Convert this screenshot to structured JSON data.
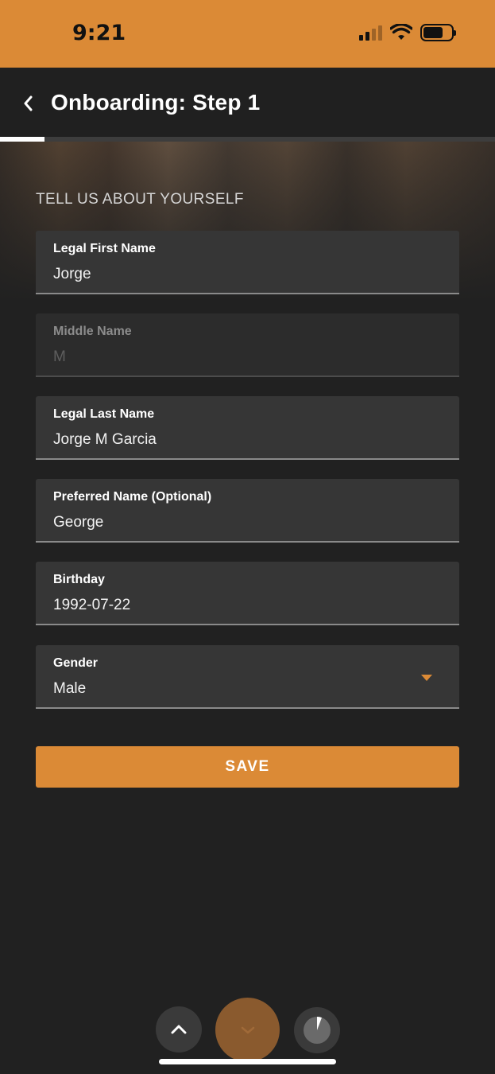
{
  "status_bar": {
    "time": "9:21",
    "background": "#db8a36"
  },
  "header": {
    "title": "Onboarding: Step 1",
    "back_icon": "chevron-left-icon"
  },
  "progress": {
    "fraction": 0.09
  },
  "section": {
    "heading": "TELL US ABOUT YOURSELF"
  },
  "form": {
    "first_name": {
      "label": "Legal First Name",
      "value": "Jorge"
    },
    "middle_name": {
      "label": "Middle Name",
      "value": "M",
      "disabled": true
    },
    "last_name": {
      "label": "Legal Last Name",
      "value": "Jorge M Garcia"
    },
    "preferred_name": {
      "label": "Preferred Name (Optional)",
      "value": "George"
    },
    "birthday": {
      "label": "Birthday",
      "value": "1992-07-22"
    },
    "gender": {
      "label": "Gender",
      "value": "Male"
    }
  },
  "actions": {
    "save_label": "SAVE"
  },
  "bottom_nav": {
    "up_icon": "chevron-up-icon",
    "down_icon": "chevron-down-icon",
    "timer_icon": "pie-timer-icon"
  },
  "colors": {
    "accent": "#db8a36",
    "background": "#212121",
    "field": "#363636"
  }
}
